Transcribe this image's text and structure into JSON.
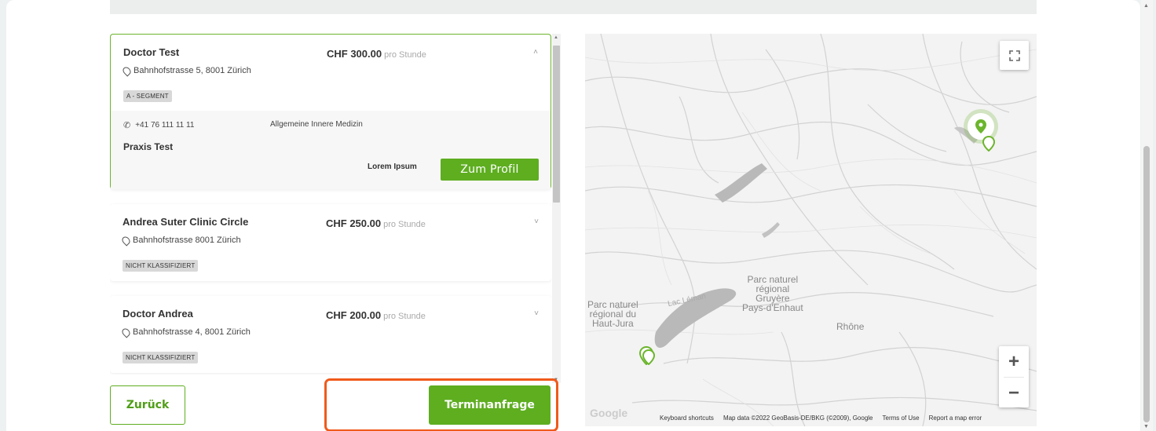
{
  "doctors": [
    {
      "name": "Doctor Test",
      "price": "CHF 300.00",
      "price_unit": "pro Stunde",
      "address": "Bahnhofstrasse 5, 8001 Zürich",
      "badge": "A - SEGMENT",
      "chevron": "˄",
      "phone": "+41 76 111 11 11",
      "specialty": "Allgemeine Innere Medizin",
      "praxis": "Praxis Test",
      "lorem": "Lorem Ipsum",
      "profile_button": "Zum Profil"
    },
    {
      "name": "Andrea Suter Clinic Circle",
      "price": "CHF 250.00",
      "price_unit": "pro Stunde",
      "address": "Bahnhofstrasse 8001 Zürich",
      "badge": "NICHT KLASSIFIZIERT",
      "chevron": "˅"
    },
    {
      "name": "Doctor Andrea",
      "price": "CHF 200.00",
      "price_unit": "pro Stunde",
      "address": "Bahnhofstrasse 4, 8001 Zürich",
      "badge": "NICHT KLASSIFIZIERT",
      "chevron": "˅"
    }
  ],
  "buttons": {
    "back": "Zurück",
    "request": "Terminanfrage"
  },
  "map": {
    "labels": {
      "jura": "Parc naturel\nrégional du\nHaut-Jura",
      "leman": "Lac Léman",
      "gruyere": "Parc naturel\nrégional\nGruyère\nPays-d'Enhaut",
      "rhone": "Rhône"
    },
    "google": "Google",
    "attribution": {
      "shortcuts": "Keyboard shortcuts",
      "data": "Map data ©2022 GeoBasis-DE/BKG (©2009), Google",
      "terms": "Terms of Use",
      "report": "Report a map error"
    },
    "zoom_in": "+",
    "zoom_out": "−",
    "marker_color": "#6cb52d"
  },
  "colors": {
    "accent": "#5eae20",
    "highlight": "#f05a1a"
  }
}
